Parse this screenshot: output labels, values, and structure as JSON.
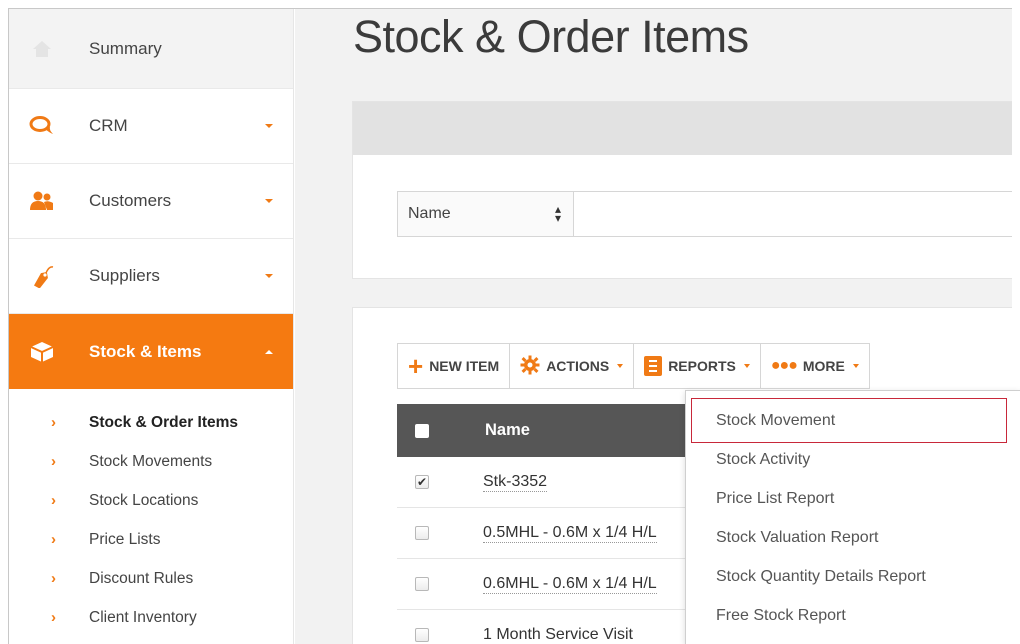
{
  "sidebar": {
    "items": [
      {
        "label": "Summary",
        "icon": "home-icon"
      },
      {
        "label": "CRM",
        "icon": "chat-icon"
      },
      {
        "label": "Customers",
        "icon": "users-icon"
      },
      {
        "label": "Suppliers",
        "icon": "tag-icon"
      },
      {
        "label": "Stock & Items",
        "icon": "box-icon"
      }
    ],
    "sub_items": [
      {
        "label": "Stock & Order Items"
      },
      {
        "label": "Stock Movements"
      },
      {
        "label": "Stock Locations"
      },
      {
        "label": "Price Lists"
      },
      {
        "label": "Discount Rules"
      },
      {
        "label": "Client Inventory"
      }
    ]
  },
  "main": {
    "title": "Stock & Order Items",
    "filter": {
      "field": "Name"
    },
    "toolbar": {
      "new_item": "NEW ITEM",
      "actions": "ACTIONS",
      "reports": "REPORTS",
      "more": "MORE"
    },
    "table": {
      "header": "Name",
      "rows": [
        {
          "name": "Stk-3352",
          "checked": true
        },
        {
          "name": "0.5MHL - 0.6M x 1/4 H/L",
          "checked": false
        },
        {
          "name": "0.6MHL - 0.6M x 1/4 H/L",
          "checked": false
        },
        {
          "name": "1 Month Service Visit",
          "checked": false
        }
      ]
    },
    "reports_menu": [
      "Stock Movement",
      "Stock Activity",
      "Price List Report",
      "Stock Valuation Report",
      "Stock Quantity Details Report",
      "Free Stock Report"
    ]
  },
  "colors": {
    "accent": "#f57a11",
    "highlight": "#c8283a",
    "header": "#565656"
  }
}
